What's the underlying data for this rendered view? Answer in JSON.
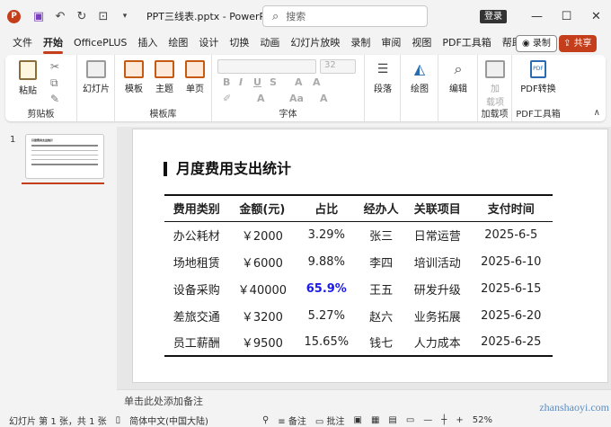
{
  "titlebar": {
    "doc_title": "PPT三线表.pptx - PowerPo...",
    "search_placeholder": "搜索",
    "login": "登录",
    "minimize": "—",
    "maximize": "☐",
    "close": "✕"
  },
  "menu": {
    "tabs": [
      "文件",
      "开始",
      "OfficePLUS",
      "插入",
      "绘图",
      "设计",
      "切换",
      "动画",
      "幻灯片放映",
      "录制",
      "审阅",
      "视图",
      "PDF工具箱",
      "帮助"
    ],
    "record": "◉ 录制",
    "share": "共享"
  },
  "ribbon": {
    "paste": "粘贴",
    "clipboard": "剪贴板",
    "slide_lib": "幻灯片",
    "template": "模板",
    "theme": "主题",
    "single_page": "单页",
    "template_lib": "模板库",
    "font_size": "32",
    "font": "字体",
    "paragraph": "段落",
    "drawing": "绘图",
    "editing": "编辑",
    "load_items": "加载项",
    "addin": "加\n载项",
    "pdf_convert": "PDF转换",
    "pdf_toolbox": "PDF工具箱"
  },
  "thumbs": {
    "slide_number": "1",
    "thumb_title": "月度费用支出统计"
  },
  "slide": {
    "title": "月度费用支出统计",
    "headers": [
      "费用类别",
      "金额(元)",
      "占比",
      "经办人",
      "关联项目",
      "支付时间"
    ],
    "rows": [
      [
        "办公耗材",
        "￥2000",
        "3.29%",
        "张三",
        "日常运营",
        "2025-6-5"
      ],
      [
        "场地租赁",
        "￥6000",
        "9.88%",
        "李四",
        "培训活动",
        "2025-6-10"
      ],
      [
        "设备采购",
        "￥40000",
        "65.9%",
        "王五",
        "研发升级",
        "2025-6-15"
      ],
      [
        "差旅交通",
        "￥3200",
        "5.27%",
        "赵六",
        "业务拓展",
        "2025-6-20"
      ],
      [
        "员工薪酬",
        "￥9500",
        "15.65%",
        "钱七",
        "人力成本",
        "2025-6-25"
      ]
    ]
  },
  "notes": "单击此处添加备注",
  "status": {
    "slide_info": "幻灯片 第 1 张，共 1 张",
    "language": "简体中文(中国大陆)",
    "notes": "备注",
    "comments": "批注",
    "zoom": "52%"
  },
  "watermark": "zhanshaoyi.com"
}
